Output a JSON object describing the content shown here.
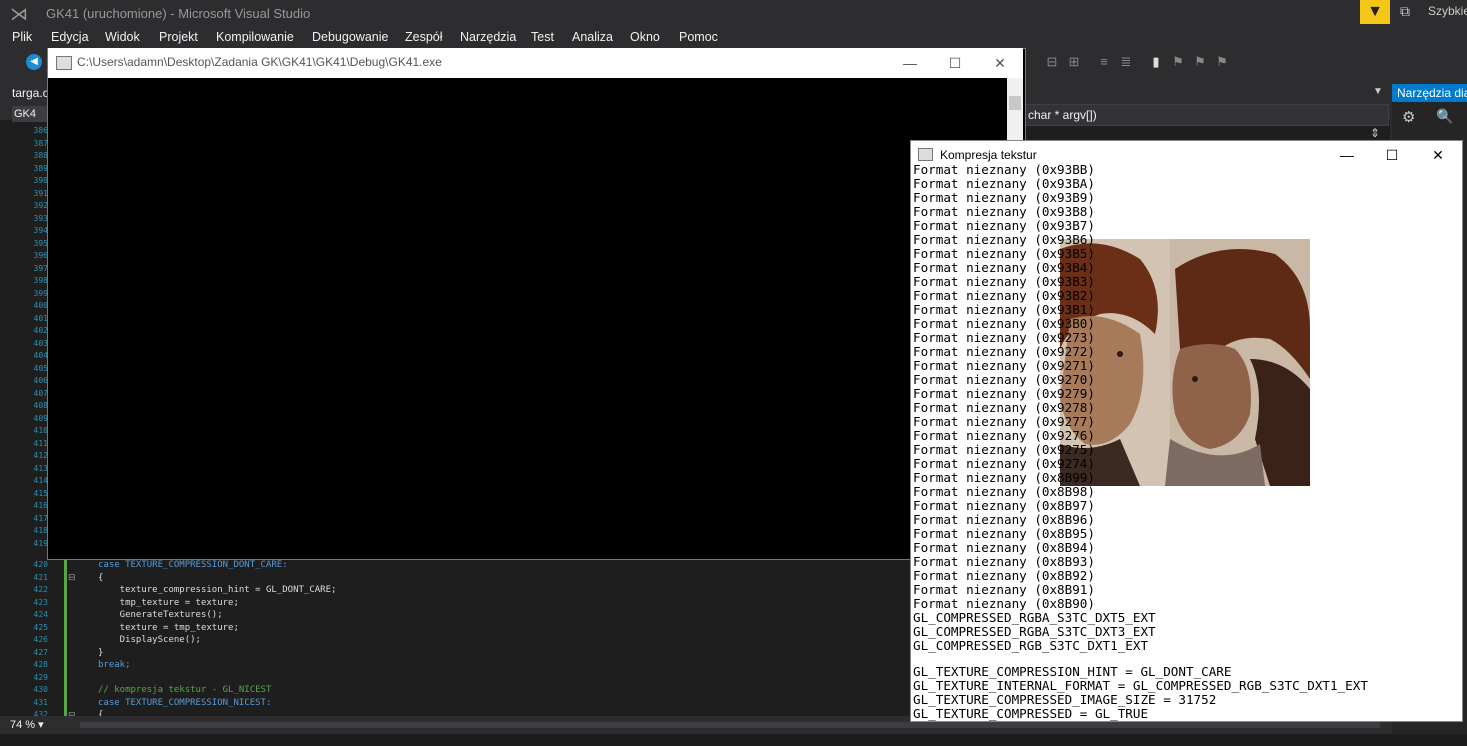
{
  "vs": {
    "title": "GK41 (uruchomione) - Microsoft Visual Studio",
    "quick_launch": "Szybkie",
    "menu": [
      "Plik",
      "Edycja",
      "Widok",
      "Projekt",
      "Kompilowanie",
      "Debugowanie",
      "Zespół",
      "Narzędzia",
      "Test",
      "Analiza",
      "Okno",
      "Pomoc"
    ],
    "tabs": {
      "targa": "targa.c",
      "gk": "GK4"
    },
    "func_dropdown": "char * argv[])",
    "zoom": "74 %",
    "right_panel_title": "Narzędzia dia"
  },
  "editor": {
    "line_numbers_top": [
      "386",
      "387",
      "388",
      "389",
      "390",
      "391",
      "392",
      "393",
      "394",
      "395",
      "396",
      "397",
      "398",
      "399",
      "400",
      "401",
      "402",
      "403",
      "404",
      "405",
      "406",
      "407",
      "408",
      "409",
      "410",
      "411",
      "412",
      "413",
      "414",
      "415",
      "416",
      "417",
      "418",
      "419"
    ],
    "lines": [
      {
        "num": "420",
        "text": "case TEXTURE_COMPRESSION_DONT_CARE:"
      },
      {
        "num": "421",
        "text": "{"
      },
      {
        "num": "422",
        "text": "    texture_compression_hint = GL_DONT_CARE;"
      },
      {
        "num": "423",
        "text": "    tmp_texture = texture;"
      },
      {
        "num": "424",
        "text": "    GenerateTextures();"
      },
      {
        "num": "425",
        "text": "    texture = tmp_texture;"
      },
      {
        "num": "426",
        "text": "    DisplayScene();"
      },
      {
        "num": "427",
        "text": "}"
      },
      {
        "num": "428",
        "text": "break;"
      },
      {
        "num": "429",
        "text": ""
      },
      {
        "num": "430",
        "text": "// kompresja tekstur - GL_NICEST"
      },
      {
        "num": "431",
        "text": "case TEXTURE_COMPRESSION_NICEST:"
      },
      {
        "num": "432",
        "text": "{"
      }
    ]
  },
  "console": {
    "path": "C:\\Users\\adamn\\Desktop\\Zadania GK\\GK41\\GK41\\Debug\\GK41.exe",
    "minimize": "—",
    "maximize": "☐",
    "close": "✕"
  },
  "komp": {
    "title": "Kompresja tekstur",
    "minimize": "—",
    "maximize": "☐",
    "close": "✕",
    "lines": [
      "Format nieznany (0x93BB)",
      "Format nieznany (0x93BA)",
      "Format nieznany (0x93B9)",
      "Format nieznany (0x93B8)",
      "Format nieznany (0x93B7)",
      "Format nieznany (0x93B6)",
      "Format nieznany (0x93B5)",
      "Format nieznany (0x93B4)",
      "Format nieznany (0x93B3)",
      "Format nieznany (0x93B2)",
      "Format nieznany (0x93B1)",
      "Format nieznany (0x93B0)",
      "Format nieznany (0x9273)",
      "Format nieznany (0x9272)",
      "Format nieznany (0x9271)",
      "Format nieznany (0x9270)",
      "Format nieznany (0x9279)",
      "Format nieznany (0x9278)",
      "Format nieznany (0x9277)",
      "Format nieznany (0x9276)",
      "Format nieznany (0x9275)",
      "Format nieznany (0x9274)",
      "Format nieznany (0x8B99)",
      "Format nieznany (0x8B98)",
      "Format nieznany (0x8B97)",
      "Format nieznany (0x8B96)",
      "Format nieznany (0x8B95)",
      "Format nieznany (0x8B94)",
      "Format nieznany (0x8B93)",
      "Format nieznany (0x8B92)",
      "Format nieznany (0x8B91)",
      "Format nieznany (0x8B90)",
      "GL_COMPRESSED_RGBA_S3TC_DXT5_EXT",
      "GL_COMPRESSED_RGBA_S3TC_DXT3_EXT",
      "GL_COMPRESSED_RGB_S3TC_DXT1_EXT"
    ],
    "status_lines": [
      "GL_TEXTURE_COMPRESSION_HINT = GL_DONT_CARE",
      "GL_TEXTURE_INTERNAL_FORMAT = GL_COMPRESSED_RGB_S3TC_DXT1_EXT",
      "GL_TEXTURE_COMPRESSED_IMAGE_SIZE = 31752",
      "GL_TEXTURE_COMPRESSED = GL_TRUE"
    ]
  },
  "colors": {
    "accent": "#007acc",
    "filter": "#f5c518"
  }
}
